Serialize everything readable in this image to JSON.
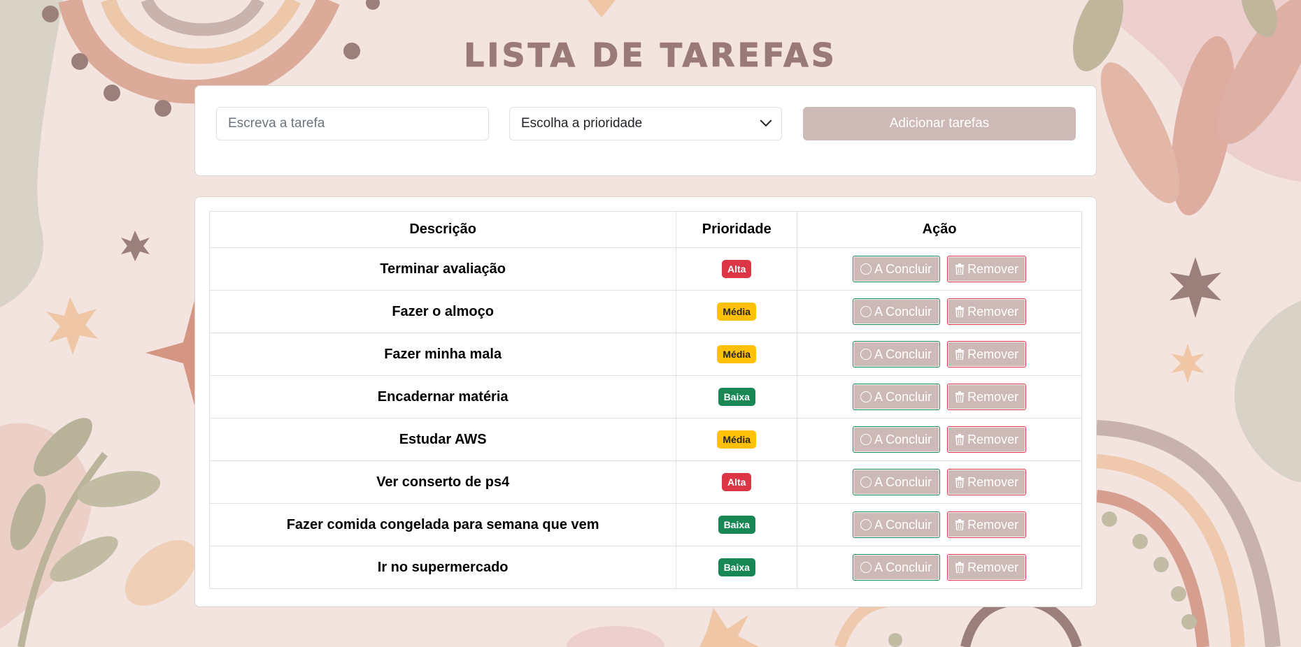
{
  "colors": {
    "title": "#9a7a76",
    "button": "#cdb9b5",
    "alta": "#dc3545",
    "media": "#ffc107",
    "baixa": "#198754",
    "background": "#f3e4e0"
  },
  "header": {
    "title": "Lista de Tarefas"
  },
  "form": {
    "task_placeholder": "Escreva a tarefa",
    "priority_value": "Escolha a prioridade",
    "add_label": "Adicionar tarefas"
  },
  "table": {
    "headers": {
      "description": "Descrição",
      "priority": "Prioridade",
      "action": "Ação"
    },
    "complete_label": "A Concluir",
    "remove_label": "Remover",
    "complete_icon": "circle-icon",
    "remove_icon": "trash-icon",
    "rows": [
      {
        "description": "Terminar avaliação",
        "priority": "Alta",
        "level": "alta"
      },
      {
        "description": "Fazer o almoço",
        "priority": "Média",
        "level": "media"
      },
      {
        "description": "Fazer minha mala",
        "priority": "Média",
        "level": "media"
      },
      {
        "description": "Encadernar matéria",
        "priority": "Baixa",
        "level": "baixa"
      },
      {
        "description": "Estudar AWS",
        "priority": "Média",
        "level": "media"
      },
      {
        "description": "Ver conserto de ps4",
        "priority": "Alta",
        "level": "alta"
      },
      {
        "description": "Fazer comida congelada para semana que vem",
        "priority": "Baixa",
        "level": "baixa"
      },
      {
        "description": "Ir no supermercado",
        "priority": "Baixa",
        "level": "baixa"
      }
    ]
  }
}
